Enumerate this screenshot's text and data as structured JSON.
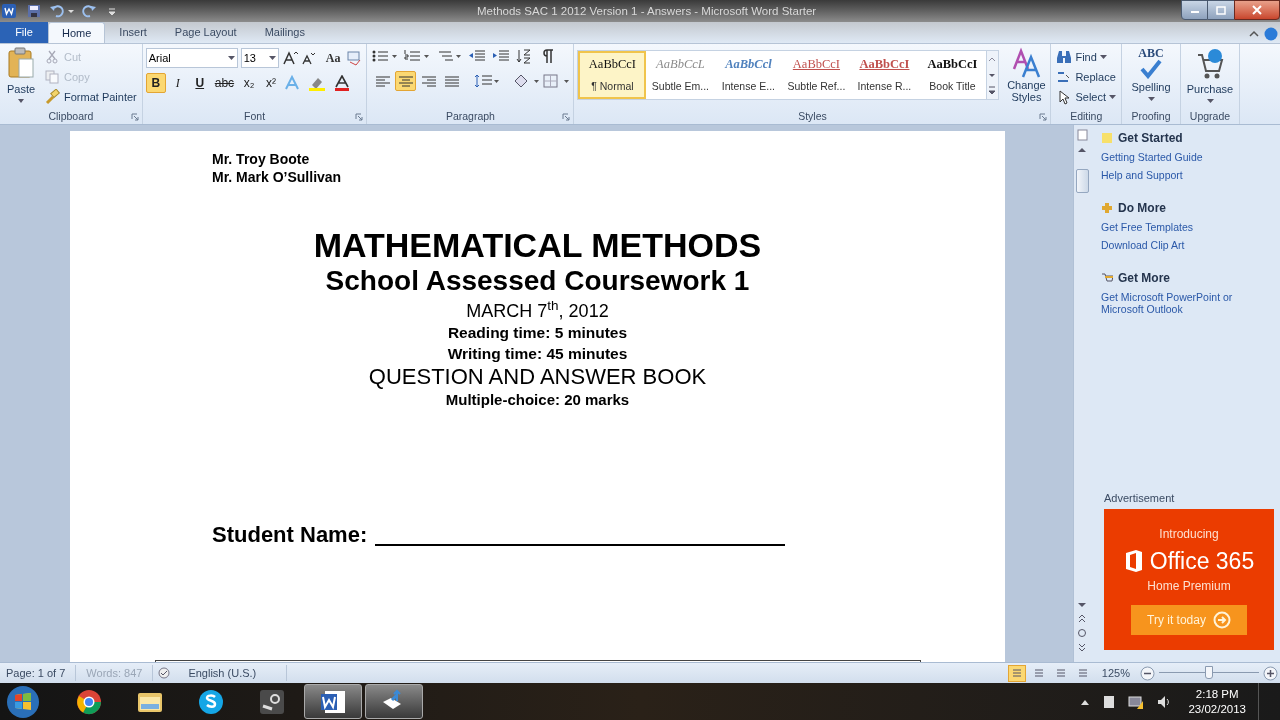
{
  "window": {
    "title": "Methods SAC 1 2012 Version 1 - Answers - Microsoft Word Starter"
  },
  "ribbon_tabs": [
    {
      "label": "File",
      "kind": "file",
      "selected": false
    },
    {
      "label": "Home",
      "kind": "tab",
      "selected": true
    },
    {
      "label": "Insert",
      "kind": "tab",
      "selected": false
    },
    {
      "label": "Page Layout",
      "kind": "tab",
      "selected": false
    },
    {
      "label": "Mailings",
      "kind": "tab",
      "selected": false
    }
  ],
  "clipboard": {
    "label": "Clipboard",
    "paste": "Paste",
    "items": [
      {
        "label": "Cut",
        "kind": "cut",
        "disabled": true
      },
      {
        "label": "Copy",
        "kind": "copy",
        "disabled": true
      },
      {
        "label": "Format Painter",
        "kind": "painter",
        "disabled": false
      }
    ]
  },
  "font": {
    "label": "Font",
    "font_name": "Arial",
    "font_size": "13",
    "change_case": "Aa",
    "format_buttons": [
      {
        "label": "B",
        "kind": "bold",
        "on": true
      },
      {
        "label": "I",
        "kind": "italic",
        "on": false
      },
      {
        "label": "U",
        "kind": "underline",
        "on": false
      },
      {
        "label": "abc",
        "kind": "strike",
        "on": false
      },
      {
        "label": "x₂",
        "kind": "sub",
        "on": false
      },
      {
        "label": "x²",
        "kind": "sup",
        "on": false
      }
    ]
  },
  "paragraph": {
    "label": "Paragraph",
    "alignment": [
      {
        "kind": "left",
        "on": false
      },
      {
        "kind": "center",
        "on": true
      },
      {
        "kind": "right",
        "on": false
      },
      {
        "kind": "justify",
        "on": false
      }
    ]
  },
  "styles": {
    "label": "Styles",
    "items": [
      {
        "preview": "AaBbCcI",
        "name": "¶ Normal",
        "kind": "normal",
        "selected": true
      },
      {
        "preview": "AaBbCcL",
        "name": "Subtle Em...",
        "kind": "subtle_emphasis",
        "selected": false
      },
      {
        "preview": "AaBbCcl",
        "name": "Intense E...",
        "kind": "intense_emphasis",
        "selected": false
      },
      {
        "preview": "AaBbCcI",
        "name": "Subtle Ref...",
        "kind": "subtle_reference",
        "selected": false
      },
      {
        "preview": "AaBbCcI",
        "name": "Intense R...",
        "kind": "intense_reference",
        "selected": false
      },
      {
        "preview": "AaBbCcI",
        "name": "Book Title",
        "kind": "book_title",
        "selected": false
      }
    ],
    "change_styles": "Change Styles"
  },
  "editing": {
    "label": "Editing",
    "items": [
      {
        "label": "Find",
        "kind": "find"
      },
      {
        "label": "Replace",
        "kind": "replace"
      },
      {
        "label": "Select",
        "kind": "select"
      }
    ]
  },
  "proofing": {
    "label": "Proofing",
    "icon_text": "ABC",
    "button": "Spelling"
  },
  "upgrade": {
    "label": "Upgrade",
    "button": "Purchase"
  },
  "document": {
    "authors": [
      "Mr. Troy Boote",
      "Mr. Mark O’Sullivan"
    ],
    "title": "MATHEMATICAL METHODS",
    "subtitle": "School Assessed Coursework 1",
    "date": "MARCH 7$^{th}$, 2012",
    "reading_time": "Reading time: 5 minutes",
    "writing_time": "Writing time: 45 minutes",
    "book": "QUESTION AND ANSWER BOOK",
    "marks": "Multiple-choice: 20 marks",
    "name_label": "Student Name:"
  },
  "side_pane": {
    "sections": [
      {
        "heading": "Get Started",
        "kind": "star",
        "links": [
          "Getting Started Guide",
          "Help and Support"
        ]
      },
      {
        "heading": "Do More",
        "kind": "plus",
        "links": [
          "Get Free Templates",
          "Download Clip Art"
        ]
      },
      {
        "heading": "Get More",
        "kind": "cart",
        "links": [
          "Get Microsoft PowerPoint or Microsoft Outlook"
        ]
      }
    ],
    "ad_label": "Advertisement",
    "ad": {
      "intro": "Introducing",
      "product": "Office 365",
      "edition": "Home Premium",
      "button": "Try it today"
    }
  },
  "status_bar": {
    "page": "Page: 1 of 7",
    "words": "Words: 847",
    "language": "English (U.S.)",
    "views": [
      {
        "selected": true
      },
      {
        "selected": false
      },
      {
        "selected": false
      },
      {
        "selected": false
      }
    ],
    "zoom": "125%",
    "zoom_slider": {
      "level": 0.5
    }
  },
  "taskbar": {
    "apps": [
      {
        "kind": "browser",
        "active": false
      },
      {
        "kind": "folder",
        "active": false
      },
      {
        "kind": "chat",
        "active": false
      },
      {
        "kind": "game",
        "active": false
      },
      {
        "kind": "word",
        "active": true
      },
      {
        "kind": "recorder",
        "active": true
      }
    ],
    "time": "2:18 PM",
    "date": "23/02/2013"
  }
}
